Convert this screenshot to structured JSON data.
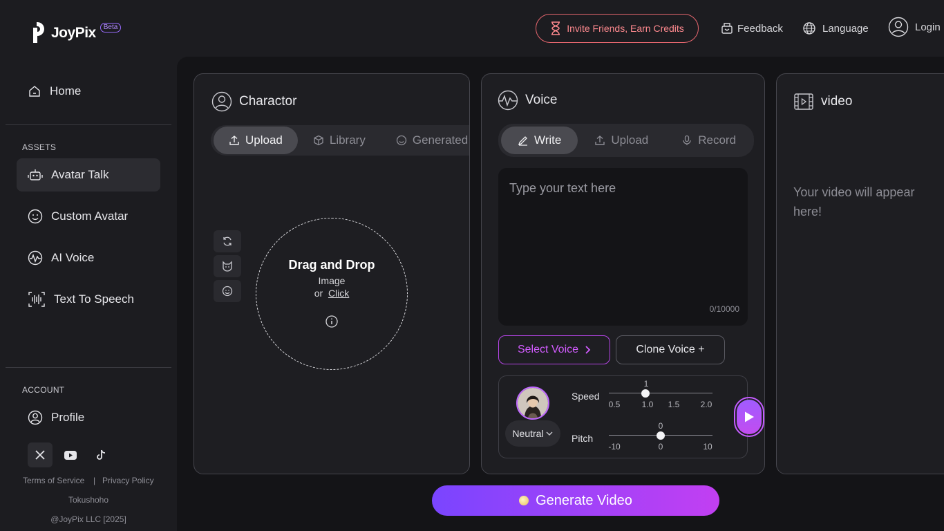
{
  "header": {
    "logo_text": "JoyPix",
    "beta": "Beta",
    "invite_label": "Invite Friends, Earn Credits",
    "feedback_label": "Feedback",
    "language_label": "Language",
    "login_label": "Login"
  },
  "sidebar": {
    "home_label": "Home",
    "assets_heading": "ASSETS",
    "assets_items": [
      {
        "label": "Avatar Talk",
        "icon": "robot-icon",
        "active": true
      },
      {
        "label": "Custom Avatar",
        "icon": "smiley-icon"
      },
      {
        "label": "AI Voice",
        "icon": "voice-wave-icon"
      },
      {
        "label": "Text To Speech",
        "icon": "soundwave-icon"
      }
    ],
    "account_heading": "ACCOUNT",
    "profile_label": "Profile",
    "social": [
      "x-icon",
      "youtube-icon",
      "tiktok-icon"
    ],
    "footer": {
      "terms": "Terms of Service",
      "divider": "|",
      "privacy": "Privacy Policy",
      "tokushoho": "Tokushoho",
      "copyright": "@JoyPix LLC [2025]"
    }
  },
  "character": {
    "title": "Charactor",
    "tabs": [
      {
        "label": "Upload",
        "active": true
      },
      {
        "label": "Library"
      },
      {
        "label": "Generated"
      }
    ],
    "drop_title": "Drag and Drop",
    "drop_sub": "Image",
    "drop_or": "or",
    "drop_click": "Click"
  },
  "voice": {
    "title": "Voice",
    "tabs": [
      {
        "label": "Write",
        "active": true
      },
      {
        "label": "Upload"
      },
      {
        "label": "Record"
      }
    ],
    "text_placeholder": "Type your text here",
    "char_count": "0/10000",
    "select_voice": "Select Voice",
    "clone_voice": "Clone Voice +",
    "emotion": "Neutral",
    "speed": {
      "label": "Speed",
      "value": "1",
      "value_num": 1.0,
      "min": 0.5,
      "max": 2.0,
      "ticks": [
        "0.5",
        "1.0",
        "1.5",
        "2.0"
      ]
    },
    "pitch": {
      "label": "Pitch",
      "value": "0",
      "value_num": 0,
      "min": -10,
      "max": 10,
      "ticks": [
        "-10",
        "0",
        "10"
      ]
    }
  },
  "video": {
    "title": "video",
    "placeholder": "Your video will appear here!"
  },
  "generate_label": "Generate Video",
  "colors": {
    "accent": "#c24cf0",
    "invite": "#ff8a8f",
    "background": "#1c1c20"
  }
}
